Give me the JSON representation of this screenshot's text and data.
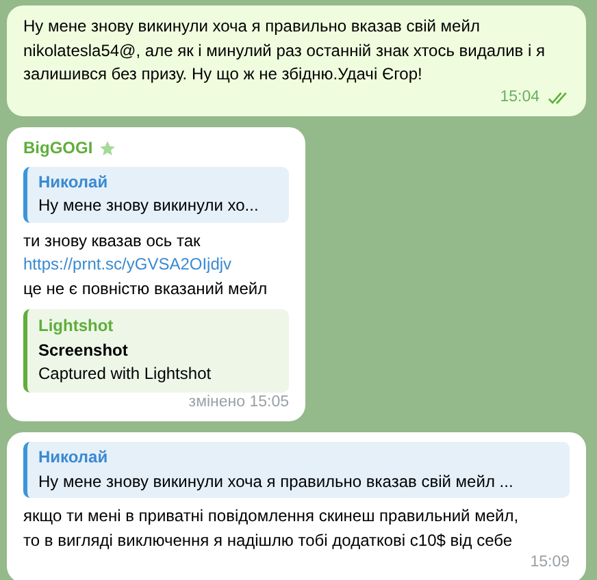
{
  "messages": [
    {
      "kind": "outgoing",
      "text": "Ну мене знову викинули хоча я правильно вказав свій мейл nikolatesla54@, але як і минулий раз останній знак хтось видалив і я залишився без призу. Ну що ж не збідню.Удачі Єгор!",
      "time": "15:04",
      "read": true
    },
    {
      "kind": "incoming",
      "sender": "BigGOGI",
      "starred": true,
      "reply": {
        "author": "Николай",
        "text": "Ну мене знову викинули хо..."
      },
      "parts": [
        {
          "kind": "text",
          "text": "ти знову квазав ось так"
        },
        {
          "kind": "link",
          "text": "https://prnt.sc/yGVSA2OIjdjv"
        },
        {
          "kind": "text",
          "text": "це не є повністю вказаний мейл"
        }
      ],
      "preview": {
        "site": "Lightshot",
        "title": "Screenshot",
        "description": "Captured with Lightshot"
      },
      "time": "змінено 15:05"
    },
    {
      "kind": "incoming",
      "reply": {
        "author": "Николай",
        "text": "Ну мене знову викинули хоча я правильно вказав свій мейл ..."
      },
      "parts": [
        {
          "kind": "text",
          "text": "якщо ти мені в приватні повідомлення скинеш правильний мейл, то в вигляді виключення я надішлю тобі додаткові с10$ від себе"
        }
      ],
      "time": "15:09"
    }
  ]
}
